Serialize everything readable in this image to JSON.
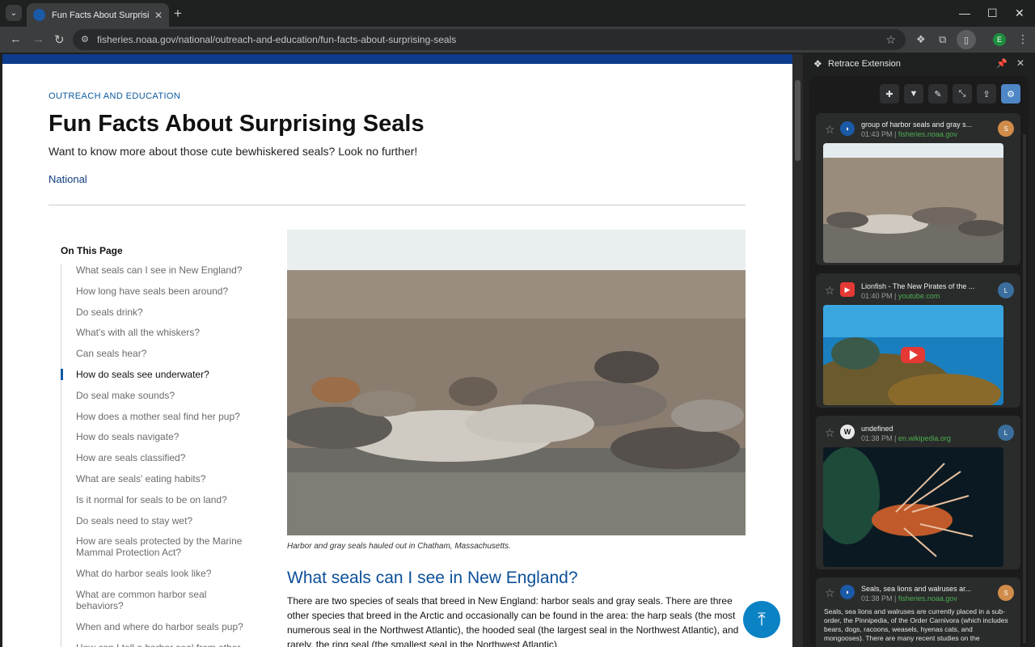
{
  "browser": {
    "tab_title": "Fun Facts About Surprising Seals",
    "url": "fisheries.noaa.gov/national/outreach-and-education/fun-facts-about-surprising-seals",
    "profile_initial": "E"
  },
  "page": {
    "eyebrow": "OUTREACH AND EDUCATION",
    "title": "Fun Facts About Surprising Seals",
    "subtitle": "Want to know more about those cute bewhiskered seals? Look no further!",
    "region": "National",
    "toc_heading": "On This Page",
    "toc": [
      "What seals can I see in New England?",
      "How long have seals been around?",
      "Do seals drink?",
      "What's with all the whiskers?",
      "Can seals hear?",
      "How do seals see underwater?",
      "Do seal make sounds?",
      "How does a mother seal find her pup?",
      "How do seals navigate?",
      "How are seals classified?",
      "What are seals' eating habits?",
      "Is it normal for seals to be on land?",
      "Do seals need to stay wet?",
      "How are seals protected by the Marine Mammal Protection Act?",
      "What do harbor seals look like?",
      "What are common harbor seal behaviors?",
      "When and where do harbor seals pup?",
      "How can I tell a harbor seal from other seals?"
    ],
    "active_toc_index": 5,
    "caption": "Harbor and gray seals hauled out in Chatham, Massachusetts.",
    "section_heading": "What seals can I see in New England?",
    "body": "There are two species of seals that breed in New England: harbor seals and gray seals. There are three other species that breed in the Arctic and occasionally can be found in the area: the harp seals (the most numerous seal in the Northwest Atlantic), the hooded seal (the largest seal in the Northwest Atlantic), and rarely, the ring seal (the smallest seal in the Northwest Atlantic)."
  },
  "extension": {
    "name": "Retrace Extension",
    "cards": [
      {
        "title": "group of harbor seals and gray s...",
        "time": "01:43 PM",
        "domain": "fisheries.noaa.gov",
        "avatar": "S",
        "avatar_color": "#d08c4a"
      },
      {
        "title": "Lionfish - The New Pirates of the ...",
        "time": "01:40 PM",
        "domain": "youtube.com",
        "avatar": "L",
        "avatar_color": "#3b6e9c"
      },
      {
        "title": "undefined",
        "time": "01:38 PM",
        "domain": "en.wikipedia.org",
        "avatar": "L",
        "avatar_color": "#3b6e9c"
      },
      {
        "title": "Seals, sea lions and walruses ar...",
        "time": "01:38 PM",
        "domain": "fisheries.noaa.gov",
        "avatar": "S",
        "avatar_color": "#d08c4a",
        "snippet": "Seals, sea lions and walruses are currently placed in a sub-order, the Pinnipedia, of the Order Carnivora (which includes bears, dogs, racoons, weasels, hyenas cats, and mongooses). There are many recent studies on the"
      }
    ]
  },
  "colors": {
    "noaa_blue": "#0e3c8c",
    "link_blue": "#0c5aa0",
    "scroll_top": "#0b82c4",
    "gear_accent": "#4f86c6"
  }
}
